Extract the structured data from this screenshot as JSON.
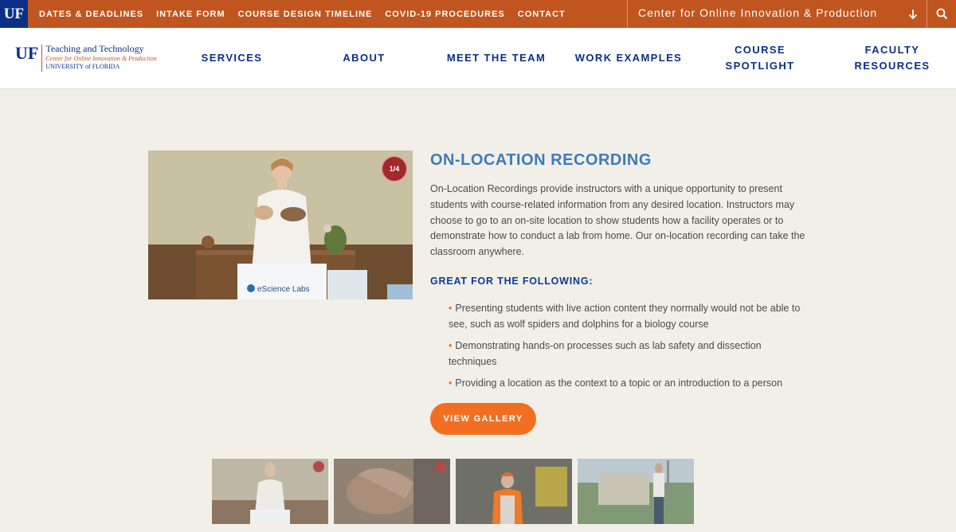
{
  "utility_bar": {
    "uf_badge": "UF",
    "links": [
      "DATES & DEADLINES",
      "INTAKE FORM",
      "COURSE DESIGN TIMELINE",
      "COVID-19 PROCEDURES",
      "CONTACT"
    ],
    "center_title": "Center for Online Innovation & Production",
    "arrow_icon": "arrow-down-icon",
    "search_icon": "search-icon"
  },
  "header": {
    "logo": {
      "mark": "UF",
      "line1": "Teaching and Technology",
      "line2": "Center for Online Innovation & Production",
      "line3": "UNIVERSITY of FLORIDA"
    },
    "nav": [
      {
        "line1": "SERVICES",
        "line2": ""
      },
      {
        "line1": "ABOUT",
        "line2": ""
      },
      {
        "line1": "MEET THE TEAM",
        "line2": ""
      },
      {
        "line1": "WORK EXAMPLES",
        "line2": ""
      },
      {
        "line1": "COURSE",
        "line2": "SPOTLIGHT"
      },
      {
        "line1": "FACULTY",
        "line2": "RESOURCES"
      }
    ]
  },
  "content": {
    "media_badge": "1/4",
    "media_sign": "eScience Labs",
    "title": "ON-LOCATION RECORDING",
    "description": "On-Location Recordings provide instructors with a unique opportunity to present students with course-related information from any desired location. Instructors may choose to go to an on-site location to show students how a facility operates or to demonstrate how to conduct a lab from home. Our on-location recording can take the classroom anywhere.",
    "subheading": "GREAT FOR THE FOLLOWING:",
    "bullet_glyph": "•",
    "bullets": [
      "Presenting students with live action content they normally would not be able to see, such as wolf spiders and dolphins for a biology course",
      "Demonstrating hands-on processes such as lab safety and dissection techniques",
      "Providing a location as the context to a topic or an introduction to a person"
    ],
    "gallery_button": "VIEW GALLERY"
  },
  "colors": {
    "topbar": "#c0551f",
    "uf_blue": "#0b2f87",
    "title_blue": "#3f7bb8",
    "accent_orange": "#f26f21",
    "page_bg": "#f2efe9"
  }
}
